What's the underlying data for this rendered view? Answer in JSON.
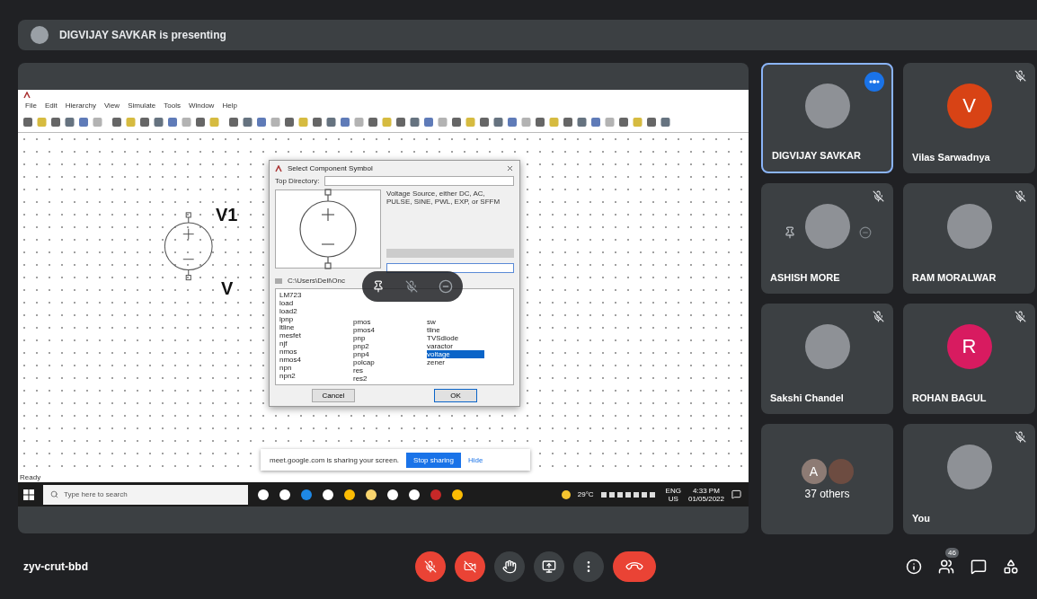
{
  "presenter_banner": {
    "text": "DIGVIJAY SAVKAR is presenting"
  },
  "shared_screen": {
    "menu": [
      "File",
      "Edit",
      "Hierarchy",
      "View",
      "Simulate",
      "Tools",
      "Window",
      "Help"
    ],
    "schematic": {
      "name_label": "V1",
      "value_label": "V"
    },
    "status": "Ready",
    "dialog": {
      "title": "Select Component Symbol",
      "top_directory_label": "Top Directory:",
      "description": "Voltage Source, either DC, AC, PULSE, SINE, PWL, EXP, or SFFM",
      "path_prefix": "C:\\Users\\Dell\\Onc",
      "list_columns": [
        [
          {
            "label": "LM723",
            "selected": false
          },
          {
            "label": "load",
            "selected": false
          },
          {
            "label": "load2",
            "selected": false
          },
          {
            "label": "lpnp",
            "selected": false
          },
          {
            "label": "ltline",
            "selected": false
          },
          {
            "label": "mesfet",
            "selected": false
          },
          {
            "label": "njf",
            "selected": false
          },
          {
            "label": "nmos",
            "selected": false
          },
          {
            "label": "nmos4",
            "selected": false
          },
          {
            "label": "npn",
            "selected": false
          },
          {
            "label": "npn2",
            "selected": false
          }
        ],
        [
          {
            "label": "pmos",
            "selected": false
          },
          {
            "label": "pmos4",
            "selected": false
          },
          {
            "label": "pnp",
            "selected": false
          },
          {
            "label": "pnp2",
            "selected": false
          },
          {
            "label": "pnp4",
            "selected": false
          },
          {
            "label": "polcap",
            "selected": false
          },
          {
            "label": "res",
            "selected": false
          },
          {
            "label": "res2",
            "selected": false
          }
        ],
        [
          {
            "label": "sw",
            "selected": false
          },
          {
            "label": "tline",
            "selected": false
          },
          {
            "label": "TVSdiode",
            "selected": false
          },
          {
            "label": "varactor",
            "selected": false
          },
          {
            "label": "voltage",
            "selected": true
          },
          {
            "label": "zener",
            "selected": false
          }
        ]
      ],
      "buttons": [
        "Cancel",
        "OK"
      ]
    },
    "sharing_bar": {
      "text": "meet.google.com is sharing your screen.",
      "stop": "Stop sharing",
      "hide": "Hide"
    },
    "taskbar": {
      "search_placeholder": "Type here to search",
      "weather": "29°C",
      "language": [
        "ENG",
        "US"
      ],
      "time": "4:33 PM",
      "date": "01/05/2022"
    }
  },
  "tiles": [
    {
      "kind": "photo",
      "name": "DIGVIJAY SAVKAR",
      "speaking": true,
      "muted": false,
      "hovered": false
    },
    {
      "kind": "letter",
      "name": "Vilas Sarwadnya",
      "letter": "V",
      "color": "#d84315",
      "speaking": false,
      "muted": true,
      "hovered": false
    },
    {
      "kind": "photo",
      "name": "ASHISH MORE",
      "speaking": false,
      "muted": true,
      "hovered": true
    },
    {
      "kind": "photo",
      "name": "RAM MORALWAR",
      "speaking": false,
      "muted": true,
      "hovered": false
    },
    {
      "kind": "photo",
      "name": "Sakshi Chandel",
      "speaking": false,
      "muted": true,
      "hovered": false
    },
    {
      "kind": "letter",
      "name": "ROHAN BAGUL",
      "letter": "R",
      "color": "#d81b60",
      "speaking": false,
      "muted": true,
      "hovered": false
    },
    {
      "kind": "group",
      "name": "37 others",
      "letter": "A",
      "color": "#8d7b74",
      "speaking": false,
      "muted": false,
      "hovered": false
    },
    {
      "kind": "photo",
      "name": "You",
      "speaking": false,
      "muted": true,
      "hovered": false
    }
  ],
  "bottom_bar": {
    "meeting_code": "zyv-crut-bbd",
    "participant_count": "46",
    "controls": [
      {
        "kind": "mic",
        "on": false
      },
      {
        "kind": "camera",
        "on": false
      },
      {
        "kind": "hand",
        "on": false
      },
      {
        "kind": "present"
      },
      {
        "kind": "more"
      },
      {
        "kind": "end"
      }
    ]
  }
}
